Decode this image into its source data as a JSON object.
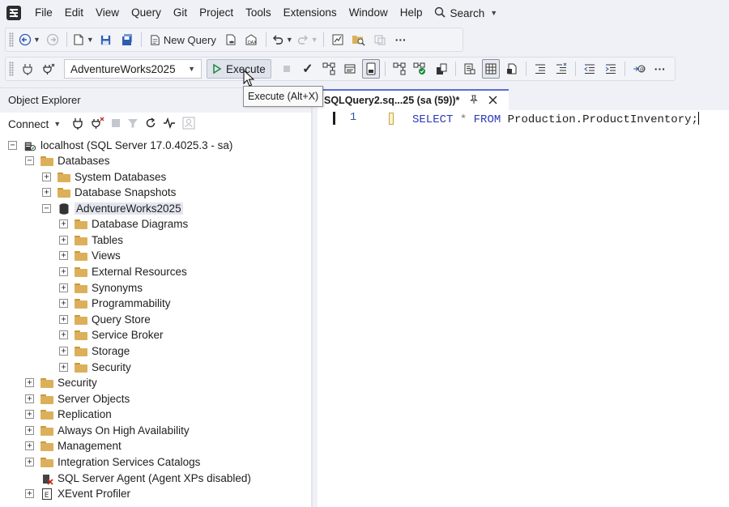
{
  "menubar": {
    "items": [
      "File",
      "Edit",
      "View",
      "Query",
      "Git",
      "Project",
      "Tools",
      "Extensions",
      "Window",
      "Help"
    ],
    "search_label": "Search"
  },
  "toolbar": {
    "new_query_label": "New Query",
    "database_selected": "AdventureWorks2025",
    "execute_label": "Execute",
    "execute_tooltip": "Execute (Alt+X)"
  },
  "object_explorer": {
    "title": "Object Explorer",
    "connect_label": "Connect",
    "server": "localhost (SQL Server 17.0.4025.3 - sa)",
    "databases": "Databases",
    "system_databases": "System Databases",
    "database_snapshots": "Database Snapshots",
    "adventureworks": "AdventureWorks2025",
    "db_children": [
      "Database Diagrams",
      "Tables",
      "Views",
      "External Resources",
      "Synonyms",
      "Programmability",
      "Query Store",
      "Service Broker",
      "Storage",
      "Security"
    ],
    "server_children": [
      "Security",
      "Server Objects",
      "Replication",
      "Always On High Availability",
      "Management",
      "Integration Services Catalogs"
    ],
    "sql_agent": "SQL Server Agent (Agent XPs disabled)",
    "xevent": "XEvent Profiler"
  },
  "editor": {
    "tab_title": "SQLQuery2.sq...25 (sa (59))*",
    "line_number": "1",
    "code": {
      "select": "SELECT",
      "star": "*",
      "from": "FROM",
      "object": "Production.ProductInventory;"
    }
  },
  "colors": {
    "keyword": "#2b3ab8",
    "tab_accent": "#5b6fd3",
    "folder": "#dcb05a"
  }
}
